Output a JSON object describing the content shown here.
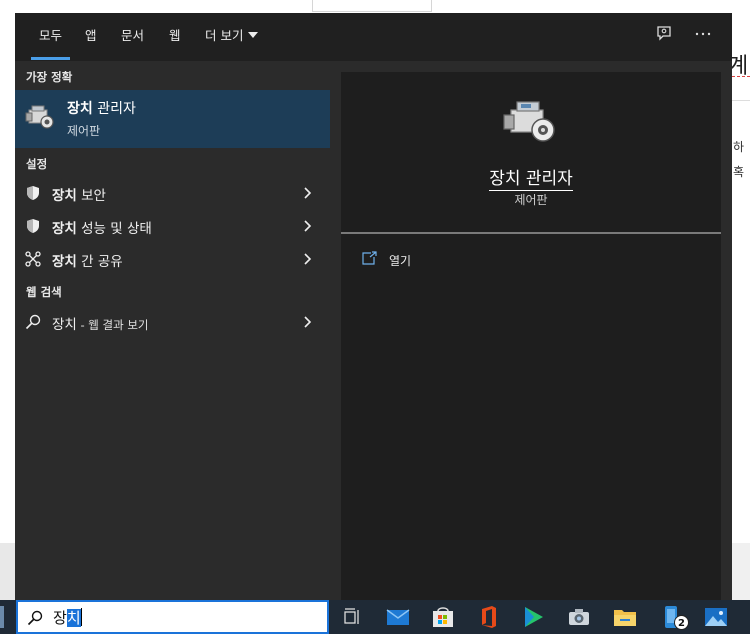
{
  "background": {
    "heading": "계",
    "text_1": "하",
    "text_2": "혹"
  },
  "tabs": [
    {
      "label": "모두",
      "active": true
    },
    {
      "label": "앱"
    },
    {
      "label": "문서"
    },
    {
      "label": "웹"
    },
    {
      "label": "더 보기"
    }
  ],
  "toolbar_icons": [
    "feedback-icon",
    "more-options-icon"
  ],
  "left": {
    "best_match_header": "가장 정확",
    "best_match": {
      "title_bold": "장치",
      "title_rest": " 관리자",
      "subtitle": "제어판",
      "icon": "device-manager-icon"
    },
    "settings_header": "설정",
    "settings": [
      {
        "bold": "장치",
        "rest": " 보안",
        "icon": "shield-icon"
      },
      {
        "bold": "장치",
        "rest": " 성능 및 상태",
        "icon": "shield-icon"
      },
      {
        "bold": "장치",
        "rest": " 간 공유",
        "icon": "share-icon"
      }
    ],
    "web_header": "웹 검색",
    "web": {
      "query": "장치",
      "suffix": " - 웹 결과 보기",
      "icon": "search-icon"
    }
  },
  "right": {
    "title": "장치 관리자",
    "subtitle": "제어판",
    "open_label": "열기"
  },
  "search": {
    "typed": "장",
    "selected": "치"
  },
  "taskbar": {
    "apps": [
      "task-view-icon",
      "mail-icon",
      "store-icon",
      "office-icon",
      "media-player-icon",
      "camera-icon",
      "file-explorer-icon",
      "phone-icon",
      "photos-icon"
    ],
    "badge": "2"
  },
  "colors": {
    "accent": "#4a9ee8",
    "selected": "#1d3d57",
    "menu_bg": "#2b2b2b",
    "taskbar": "#1f2a36"
  }
}
